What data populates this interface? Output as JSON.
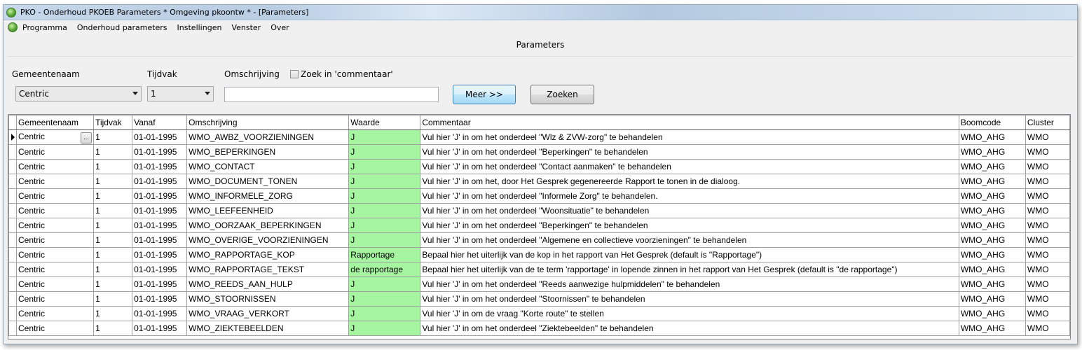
{
  "window": {
    "title": "PKO - Onderhoud PKOEB Parameters * Omgeving pkoontw * - [Parameters]"
  },
  "menu": {
    "items": [
      "Programma",
      "Onderhoud parameters",
      "Instellingen",
      "Venster",
      "Over"
    ]
  },
  "panel": {
    "title": "Parameters"
  },
  "filters": {
    "gemeentenaam_label": "Gemeentenaam",
    "gemeentenaam_value": "Centric",
    "tijdvak_label": "Tijdvak",
    "tijdvak_value": "1",
    "omschrijving_label": "Omschrijving",
    "omschrijving_value": "",
    "zoek_commentaar_label": "Zoek in 'commentaar'",
    "meer_button": "Meer >>",
    "zoeken_button": "Zoeken"
  },
  "grid": {
    "columns": [
      "Gemeentenaam",
      "Tijdvak",
      "Vanaf",
      "Omschrijving",
      "Waarde",
      "Commentaar",
      "Boomcode",
      "Cluster"
    ],
    "ellipsis": "...",
    "rows": [
      [
        "Centric",
        "1",
        "01-01-1995",
        "WMO_AWBZ_VOORZIENINGEN",
        "J",
        "Vul hier 'J' in om het onderdeel \"Wlz & ZVW-zorg\" te behandelen",
        "WMO_AHG",
        "WMO"
      ],
      [
        "Centric",
        "1",
        "01-01-1995",
        "WMO_BEPERKINGEN",
        "J",
        "Vul hier 'J' in om het onderdeel \"Beperkingen\" te behandelen",
        "WMO_AHG",
        "WMO"
      ],
      [
        "Centric",
        "1",
        "01-01-1995",
        "WMO_CONTACT",
        "J",
        "Vul hier 'J' in om het onderdeel \"Contact aanmaken\" te behandelen",
        "WMO_AHG",
        "WMO"
      ],
      [
        "Centric",
        "1",
        "01-01-1995",
        "WMO_DOCUMENT_TONEN",
        "J",
        "Vul hier 'J' in om het, door Het Gesprek gegenereerde Rapport te tonen in de dialoog.",
        "WMO_AHG",
        "WMO"
      ],
      [
        "Centric",
        "1",
        "01-01-1995",
        "WMO_INFORMELE_ZORG",
        "J",
        "Vul hier 'J' in om het onderdeel \"Informele Zorg\" te behandelen.",
        "WMO_AHG",
        "WMO"
      ],
      [
        "Centric",
        "1",
        "01-01-1995",
        "WMO_LEEFEENHEID",
        "J",
        "Vul hier 'J' in om het onderdeel \"Woonsituatie\" te behandelen",
        "WMO_AHG",
        "WMO"
      ],
      [
        "Centric",
        "1",
        "01-01-1995",
        "WMO_OORZAAK_BEPERKINGEN",
        "J",
        "Vul hier 'J' in om het onderdeel \"Beperkingen\" te behandelen",
        "WMO_AHG",
        "WMO"
      ],
      [
        "Centric",
        "1",
        "01-01-1995",
        "WMO_OVERIGE_VOORZIENINGEN",
        "J",
        "Vul hier 'J' in om het onderdeel \"Algemene en collectieve voorzieningen\" te behandelen",
        "WMO_AHG",
        "WMO"
      ],
      [
        "Centric",
        "1",
        "01-01-1995",
        "WMO_RAPPORTAGE_KOP",
        "Rapportage",
        "Bepaal hier het uiterlijk van de kop in het rapport van Het Gesprek (default is \"Rapportage\")",
        "WMO_AHG",
        "WMO"
      ],
      [
        "Centric",
        "1",
        "01-01-1995",
        "WMO_RAPPORTAGE_TEKST",
        "de rapportage",
        "Bepaal hier het uiterlijk van de te term 'rapportage' in lopende zinnen in het rapport van Het Gesprek (default is \"de rapportage\")",
        "WMO_AHG",
        "WMO"
      ],
      [
        "Centric",
        "1",
        "01-01-1995",
        "WMO_REEDS_AAN_HULP",
        "J",
        "Vul hier 'J' in om het onderdeel \"Reeds aanwezige hulpmiddelen\" te behandelen",
        "WMO_AHG",
        "WMO"
      ],
      [
        "Centric",
        "1",
        "01-01-1995",
        "WMO_STOORNISSEN",
        "J",
        "Vul hier 'J' in om het onderdeel \"Stoornissen\" te behandelen",
        "WMO_AHG",
        "WMO"
      ],
      [
        "Centric",
        "1",
        "01-01-1995",
        "WMO_VRAAG_VERKORT",
        "J",
        "Vul hier 'J' in om de vraag  \"Korte route\" te stellen",
        "WMO_AHG",
        "WMO"
      ],
      [
        "Centric",
        "1",
        "01-01-1995",
        "WMO_ZIEKTEBEELDEN",
        "J",
        "Vul hier 'J' in om het onderdeel \"Ziektebeelden\" te behandelen",
        "WMO_AHG",
        "WMO"
      ]
    ],
    "waarde_color": "#a6f5a0"
  }
}
